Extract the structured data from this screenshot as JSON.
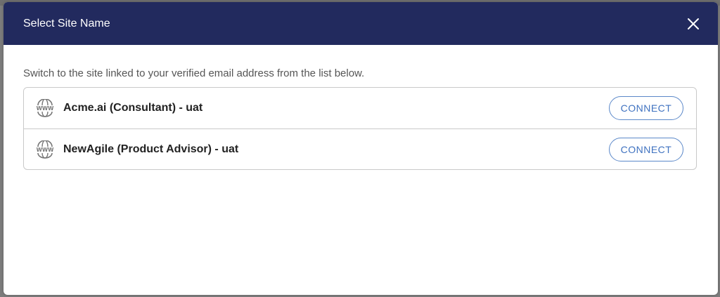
{
  "modal": {
    "title": "Select Site Name",
    "intro": "Switch to the site linked to your verified email address from the list below.",
    "close_icon": "close-icon",
    "accent_color": "#222a5e",
    "button_color": "#3f72c0"
  },
  "sites": [
    {
      "name": "Acme.ai (Consultant) - uat",
      "action": "CONNECT",
      "icon": "www-globe-icon"
    },
    {
      "name": "NewAgile (Product Advisor) - uat",
      "action": "CONNECT",
      "icon": "www-globe-icon"
    }
  ]
}
